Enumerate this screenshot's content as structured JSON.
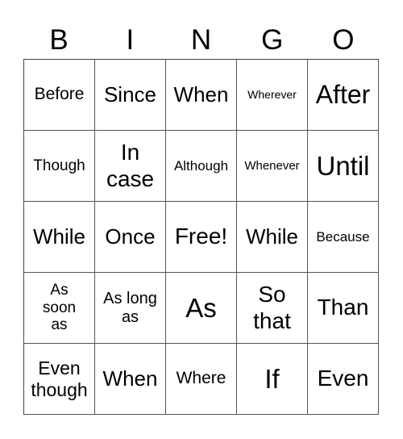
{
  "header": [
    "B",
    "I",
    "N",
    "G",
    "O"
  ],
  "cells": [
    [
      "Before",
      "Since",
      "When",
      "Wherever",
      "After"
    ],
    [
      "Though",
      "In case",
      "Although",
      "Whenever",
      "Until"
    ],
    [
      "While",
      "Once",
      "Free!",
      "While",
      "Because"
    ],
    [
      "As soon as",
      "As long as",
      "As",
      "So that",
      "Than"
    ],
    [
      "Even though",
      "When",
      "Where",
      "If",
      "Even"
    ]
  ],
  "free_space": "Free!"
}
